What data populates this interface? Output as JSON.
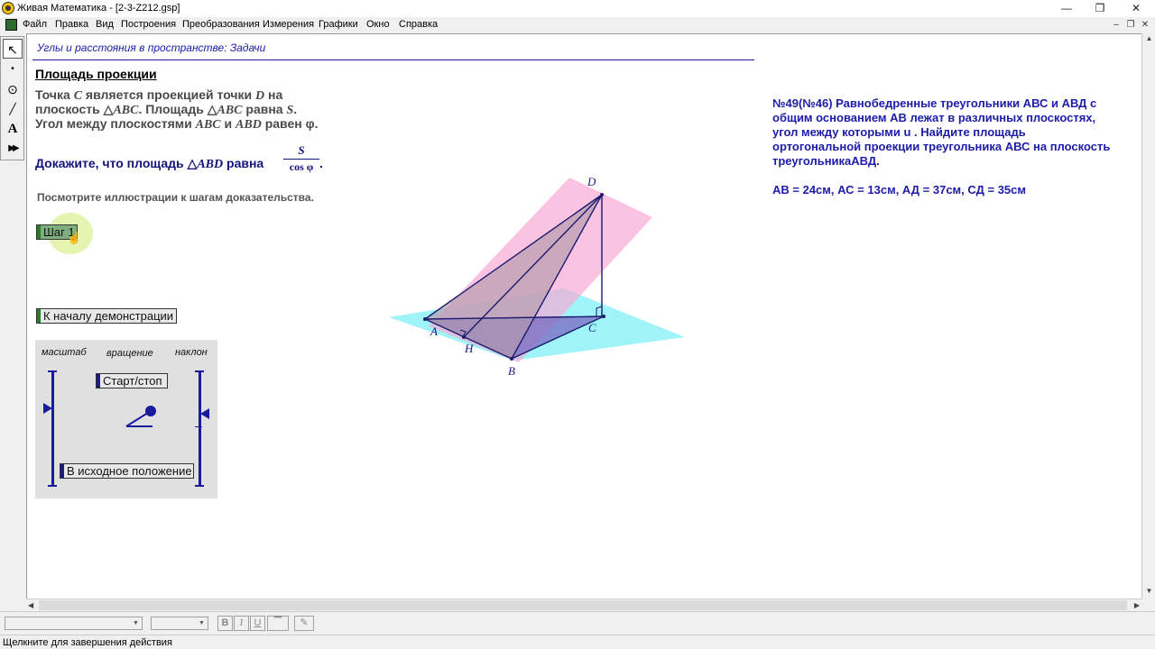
{
  "window": {
    "title": "Живая Математика - [2-3-Z212.gsp]",
    "minimize": "—",
    "restore": "❐",
    "close": "✕"
  },
  "menu": {
    "items": [
      "Файл",
      "Правка",
      "Вид",
      "Построения",
      "Преобразования",
      "Измерения",
      "Графики",
      "Окно",
      "Справка"
    ],
    "mdi": [
      "–",
      "❐",
      "✕"
    ]
  },
  "toolbox": {
    "tools": [
      {
        "name": "arrow-tool-icon",
        "glyph": "↖"
      },
      {
        "name": "point-tool-icon",
        "glyph": "•"
      },
      {
        "name": "compass-tool-icon",
        "glyph": "⊙"
      },
      {
        "name": "straightedge-tool-icon",
        "glyph": "╱"
      },
      {
        "name": "text-tool-icon",
        "glyph": "A"
      },
      {
        "name": "custom-tool-icon",
        "glyph": "▶▶"
      }
    ]
  },
  "canvas": {
    "header_title": "Углы и расстояния в пространстве: Задачи",
    "section_heading": "Площадь проекции",
    "statement": {
      "l1_a": "Точка ",
      "l1_C": "C",
      "l1_b": " является проекцией точки ",
      "l1_D": "D",
      "l1_c": " на",
      "l2_a": "плоскость ",
      "l2_tri1": "△",
      "l2_ABC1": "ABC",
      "l2_b": ". Площадь ",
      "l2_tri2": "△",
      "l2_ABC2": "ABC",
      "l2_c": " равна ",
      "l2_S": "S",
      "l2_d": ".",
      "l3_a": "Угол между плоскостями ",
      "l3_ABC": "ABC",
      "l3_b": " и ",
      "l3_ABD": "ABD",
      "l3_c": " равен ",
      "l3_phi": "φ."
    },
    "prove": {
      "text": "Докажите, что площадь ",
      "tri": "△",
      "abd": "ABD",
      "equals": " равна ",
      "numerator": "S",
      "denominator": "cos φ",
      "dot": "."
    },
    "hint": "Посмотрите иллюстрации к шагам доказательства.",
    "step_button": "Шаг 1",
    "reset_button": "К началу демонстрации",
    "control_panel": {
      "scale_label": "масштаб",
      "rotation_label": "вращение",
      "tilt_label": "наклон",
      "startstop_button": "Старт/стоп",
      "initial_button": "В исходное положение"
    },
    "figure": {
      "labels": {
        "A": "A",
        "B": "B",
        "C": "C",
        "D": "D",
        "H": "H"
      },
      "colors": {
        "pink_plane": "#f6a9d4",
        "cyan_plane": "#7ef0f6",
        "triangle_abc": "#7d6fc4",
        "triangle_abd": "#c4a9b6",
        "edge": "#1a1a6e",
        "label": "#1a1a8c"
      }
    },
    "problem": {
      "line1": "№49(№46)  Равнобедренные треугольники АВС и АВД с",
      "line2": "общим основанием АВ лежат в различных плоскостях,",
      "line3": "угол между которыми  u . Найдите площадь",
      "line4": "ортогональной проекции треугольника АВС на плоскость",
      "line5": "треугольникаАВД.",
      "given": "АВ = 24см,  АС = 13см,  АД = 37см,  СД = 35см"
    }
  },
  "format_toolbar": {
    "bold": "B",
    "italic": "I",
    "underline": "U"
  },
  "status": "Щелкните для завершения действия"
}
